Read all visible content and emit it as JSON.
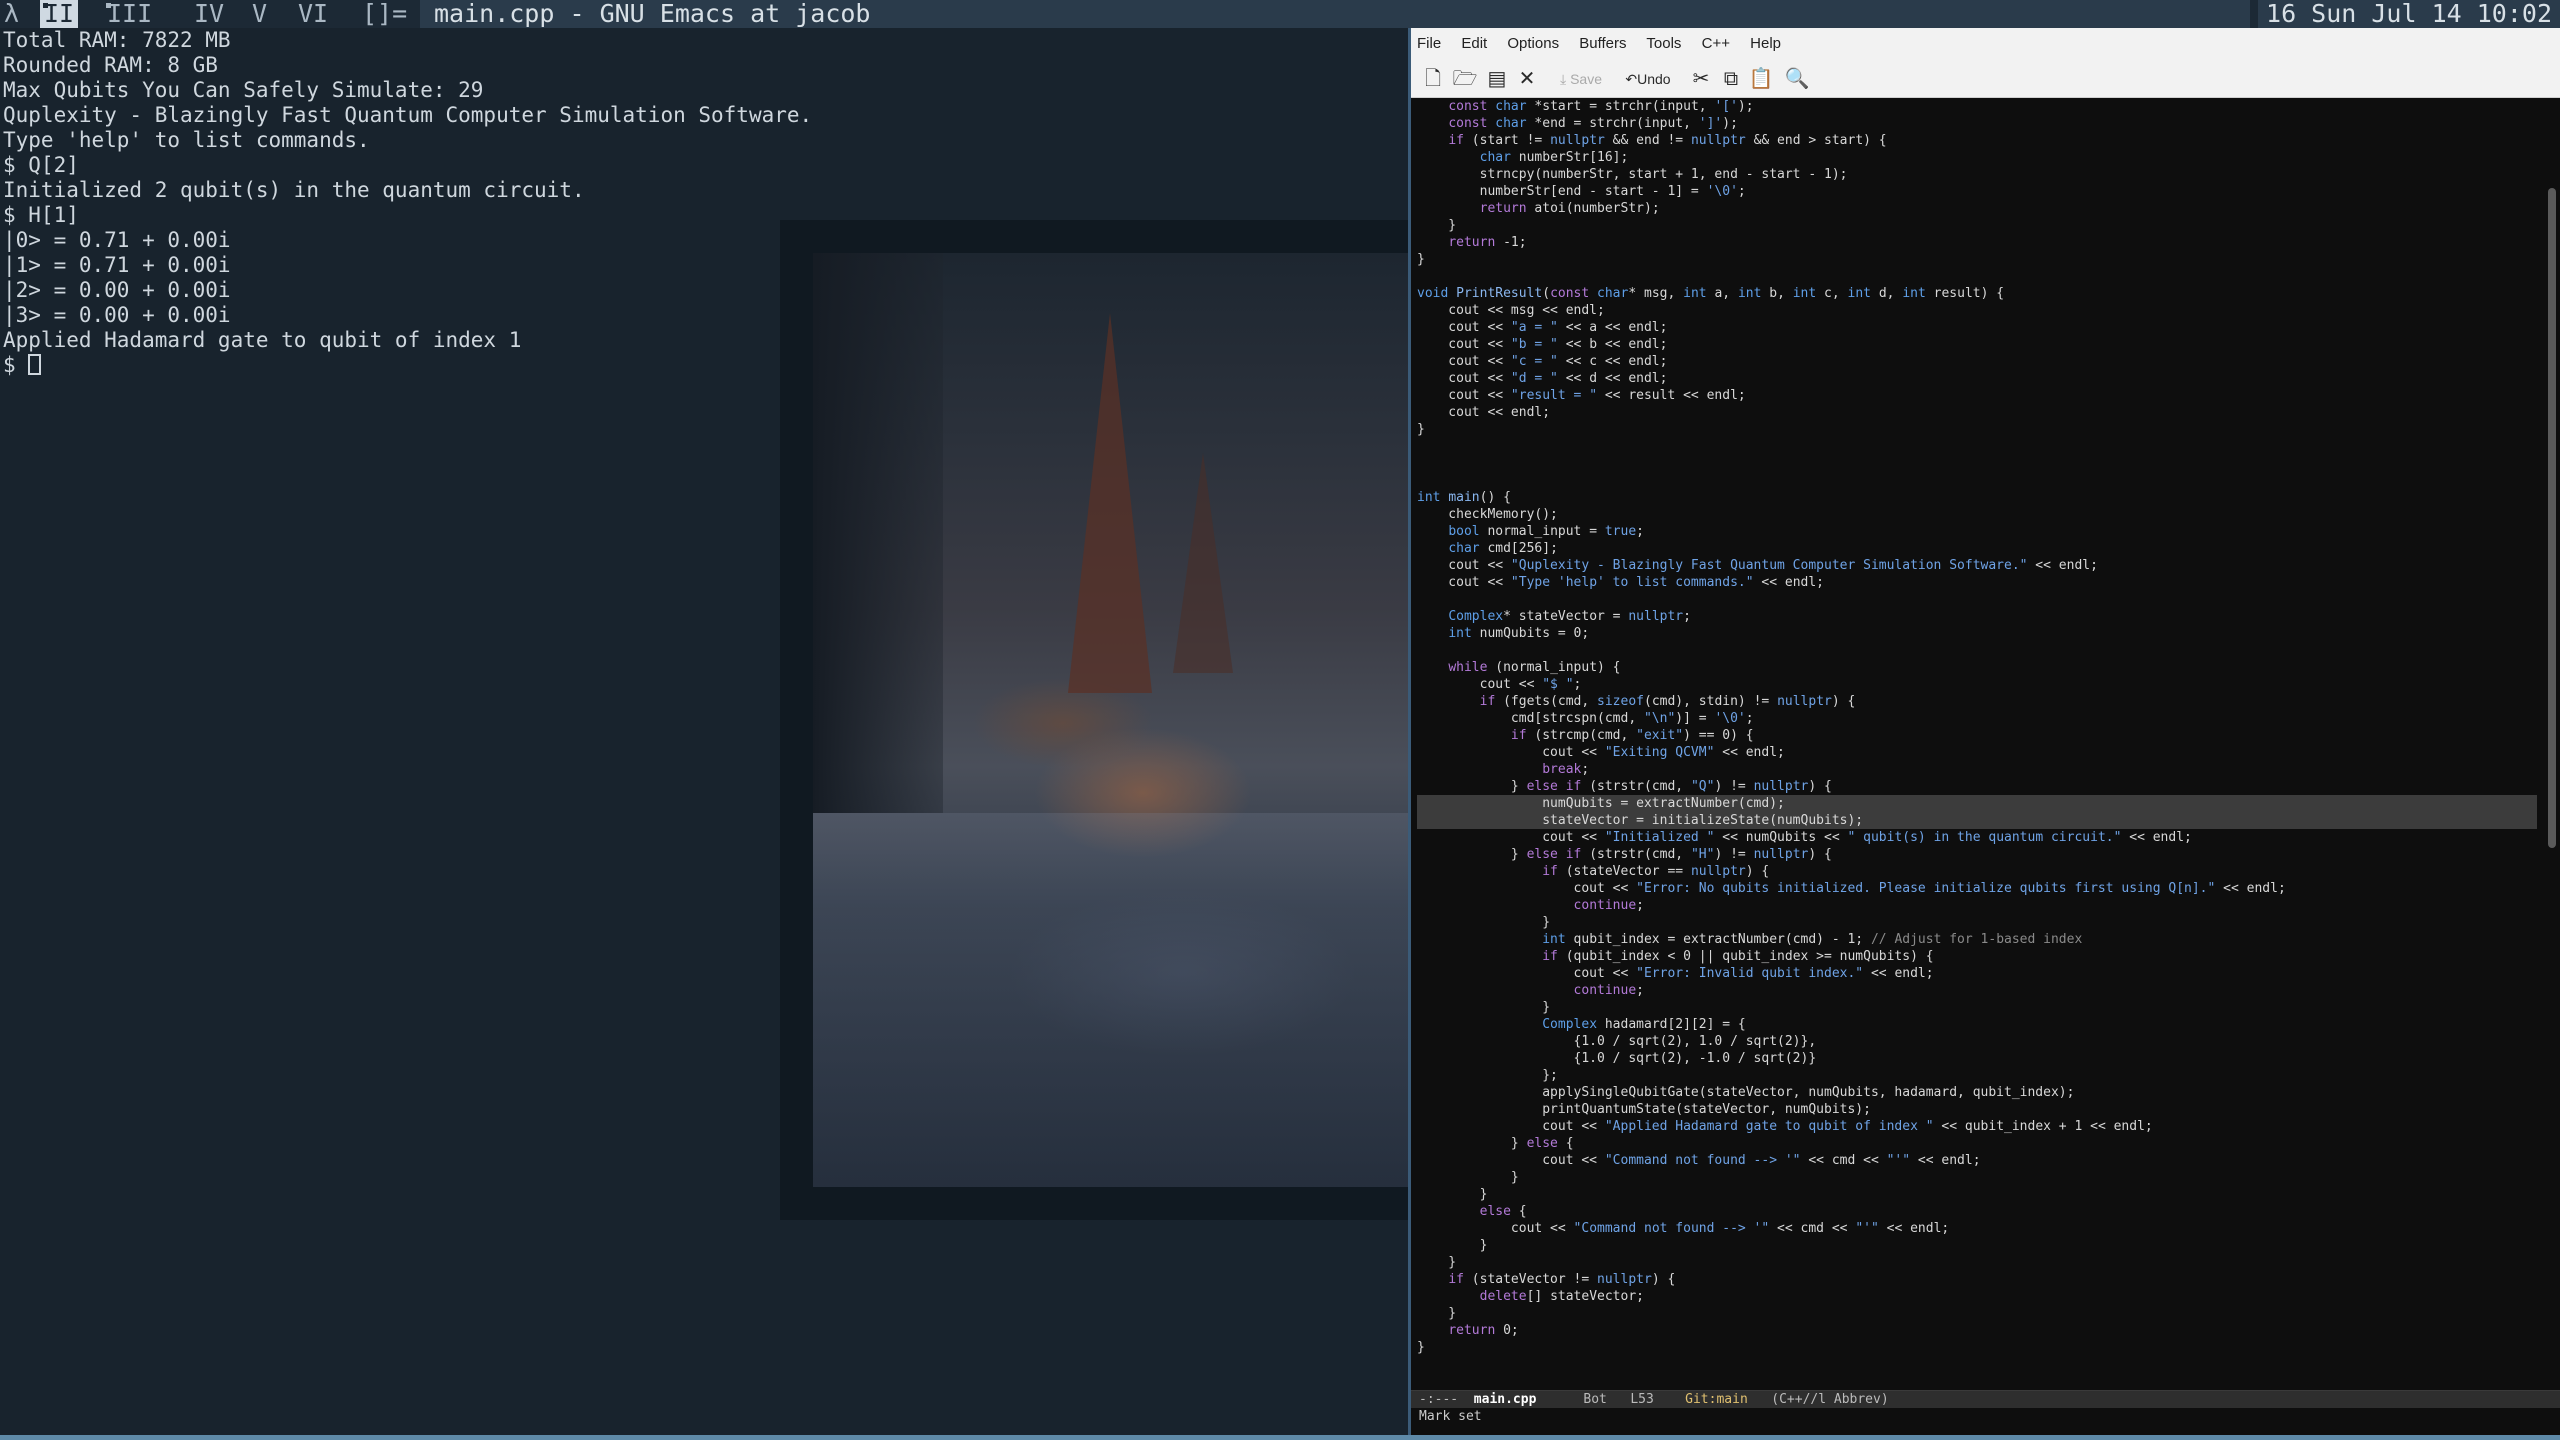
{
  "topbar": {
    "layout_symbol": "λ",
    "tags": [
      "II",
      "III",
      "IV",
      "V",
      "VI"
    ],
    "layout_indicator": "[]=",
    "window_title": "main.cpp - GNU Emacs at jacob",
    "clock": "16 Sun Jul 14 10:02"
  },
  "terminal": {
    "lines": [
      "Total RAM: 7822 MB",
      "Rounded RAM: 8 GB",
      "Max Qubits You Can Safely Simulate: 29",
      "Quplexity - Blazingly Fast Quantum Computer Simulation Software.",
      "Type 'help' to list commands.",
      "$ Q[2]",
      "Initialized 2 qubit(s) in the quantum circuit.",
      "$ H[1]",
      "|0> = 0.71 + 0.00i",
      "|1> = 0.71 + 0.00i",
      "|2> = 0.00 + 0.00i",
      "|3> = 0.00 + 0.00i",
      "Applied Hadamard gate to qubit of index 1"
    ],
    "prompt": "$ "
  },
  "emacs": {
    "menu": [
      "File",
      "Edit",
      "Options",
      "Buffers",
      "Tools",
      "C++",
      "Help"
    ],
    "toolbar": {
      "new_file": "new-file-icon",
      "open_file": "open-folder-icon",
      "open_dir": "open-directory-icon",
      "close": "close-icon",
      "save": "Save",
      "undo": "Undo",
      "cut": "cut-icon",
      "copy": "copy-icon",
      "paste": "paste-icon",
      "search": "search-icon"
    },
    "code_lines": [
      "    const char *start = strchr(input, '[');",
      "    const char *end = strchr(input, ']');",
      "    if (start != nullptr && end != nullptr && end > start) {",
      "        char numberStr[16];",
      "        strncpy(numberStr, start + 1, end - start - 1);",
      "        numberStr[end - start - 1] = '\\0';",
      "        return atoi(numberStr);",
      "    }",
      "    return -1;",
      "}",
      "",
      "void PrintResult(const char* msg, int a, int b, int c, int d, int result) {",
      "    cout << msg << endl;",
      "    cout << \"a = \" << a << endl;",
      "    cout << \"b = \" << b << endl;",
      "    cout << \"c = \" << c << endl;",
      "    cout << \"d = \" << d << endl;",
      "    cout << \"result = \" << result << endl;",
      "    cout << endl;",
      "}",
      "",
      "",
      "",
      "int main() {",
      "    checkMemory();",
      "    bool normal_input = true;",
      "    char cmd[256];",
      "    cout << \"Quplexity - Blazingly Fast Quantum Computer Simulation Software.\" << endl;",
      "    cout << \"Type 'help' to list commands.\" << endl;",
      "",
      "    Complex* stateVector = nullptr;",
      "    int numQubits = 0;",
      "",
      "    while (normal_input) {",
      "        cout << \"$ \";",
      "        if (fgets(cmd, sizeof(cmd), stdin) != nullptr) {",
      "            cmd[strcspn(cmd, \"\\n\")] = '\\0';",
      "            if (strcmp(cmd, \"exit\") == 0) {",
      "                cout << \"Exiting QCVM\" << endl;",
      "                break;",
      "            } else if (strstr(cmd, \"Q\") != nullptr) {",
      "                numQubits = extractNumber(cmd);",
      "                stateVector = initializeState(numQubits);",
      "                cout << \"Initialized \" << numQubits << \" qubit(s) in the quantum circuit.\" << endl;",
      "            } else if (strstr(cmd, \"H\") != nullptr) {",
      "                if (stateVector == nullptr) {",
      "                    cout << \"Error: No qubits initialized. Please initialize qubits first using Q[n].\" << endl;",
      "                    continue;",
      "                }",
      "                int qubit_index = extractNumber(cmd) - 1; // Adjust for 1-based index",
      "                if (qubit_index < 0 || qubit_index >= numQubits) {",
      "                    cout << \"Error: Invalid qubit index.\" << endl;",
      "                    continue;",
      "                }",
      "                Complex hadamard[2][2] = {",
      "                    {1.0 / sqrt(2), 1.0 / sqrt(2)},",
      "                    {1.0 / sqrt(2), -1.0 / sqrt(2)}",
      "                };",
      "                applySingleQubitGate(stateVector, numQubits, hadamard, qubit_index);",
      "                printQuantumState(stateVector, numQubits);",
      "                cout << \"Applied Hadamard gate to qubit of index \" << qubit_index + 1 << endl;",
      "            } else {",
      "                cout << \"Command not found --> '\" << cmd << \"'\" << endl;",
      "            }",
      "        }",
      "        else {",
      "            cout << \"Command not found --> '\" << cmd << \"'\" << endl;",
      "        }",
      "    }",
      "    if (stateVector != nullptr) {",
      "        delete[] stateVector;",
      "    }",
      "    return 0;",
      "}"
    ],
    "highlight_lines": [
      41,
      42
    ],
    "modeline": {
      "status": "-:---",
      "buffer": "main.cpp",
      "position": "Bot",
      "line": "L53",
      "git": "Git:main",
      "mode": "(C++//l Abbrev)"
    },
    "echo": "Mark set"
  },
  "colors": {
    "keyword": "#b37ad8",
    "type": "#5e9fe8",
    "string": "#6fa3e6",
    "comment": "#8a8a8a"
  }
}
